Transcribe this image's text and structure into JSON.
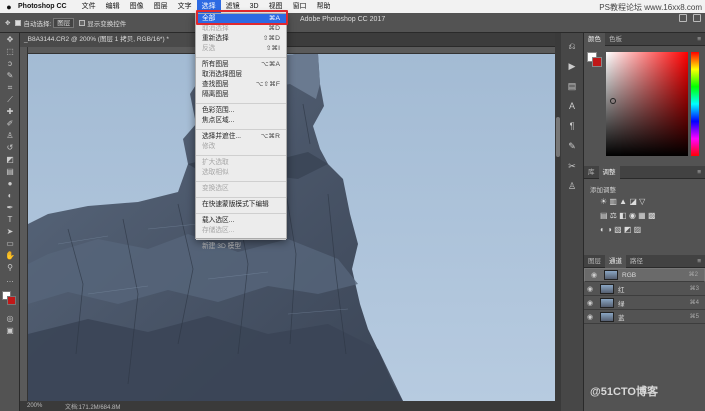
{
  "menubar": {
    "app": "Photoshop CC",
    "items": [
      "文件",
      "编辑",
      "图像",
      "图层",
      "文字",
      "选择",
      "滤镜",
      "3D",
      "视图",
      "窗口",
      "帮助"
    ],
    "active_index": 5
  },
  "options": {
    "auto_select_label": "自动选择:",
    "auto_select_value": "图层",
    "transform_label": "显示变换控件"
  },
  "window_title": "Adobe Photoshop CC 2017",
  "document": {
    "tab": "_B8A3144.CR2 @ 200% (图层 1 拷贝, RGB/16*) *",
    "zoom": "200%",
    "status": "文档:171.2M/684.8M"
  },
  "select_menu": {
    "items": [
      {
        "label": "全部",
        "shortcut": "⌘A",
        "state": "highlight"
      },
      {
        "label": "取消选择",
        "shortcut": "⌘D",
        "state": "disabled"
      },
      {
        "label": "重新选择",
        "shortcut": "⇧⌘D",
        "state": "normal"
      },
      {
        "label": "反选",
        "shortcut": "⇧⌘I",
        "state": "disabled"
      },
      {
        "sep": true
      },
      {
        "label": "所有图层",
        "shortcut": "⌥⌘A",
        "state": "normal"
      },
      {
        "label": "取消选择图层",
        "shortcut": "",
        "state": "normal"
      },
      {
        "label": "查找图层",
        "shortcut": "⌥⇧⌘F",
        "state": "normal"
      },
      {
        "label": "隔离图层",
        "shortcut": "",
        "state": "normal"
      },
      {
        "sep": true
      },
      {
        "label": "色彩范围...",
        "shortcut": "",
        "state": "normal"
      },
      {
        "label": "焦点区域...",
        "shortcut": "",
        "state": "normal"
      },
      {
        "sep": true
      },
      {
        "label": "选择并遮住...",
        "shortcut": "⌥⌘R",
        "state": "normal"
      },
      {
        "label": "修改",
        "shortcut": "",
        "state": "disabled"
      },
      {
        "sep": true
      },
      {
        "label": "扩大选取",
        "shortcut": "",
        "state": "disabled"
      },
      {
        "label": "选取相似",
        "shortcut": "",
        "state": "disabled"
      },
      {
        "sep": true
      },
      {
        "label": "变换选区",
        "shortcut": "",
        "state": "disabled"
      },
      {
        "sep": true
      },
      {
        "label": "在快速蒙版模式下编辑",
        "shortcut": "",
        "state": "normal"
      },
      {
        "sep": true
      },
      {
        "label": "载入选区...",
        "shortcut": "",
        "state": "normal"
      },
      {
        "label": "存储选区...",
        "shortcut": "",
        "state": "disabled"
      },
      {
        "sep": true
      },
      {
        "label": "新建 3D 模型",
        "shortcut": "",
        "state": "disabled"
      }
    ]
  },
  "panels": {
    "color_tabs": [
      "颜色",
      "色板"
    ],
    "adjust_tabs": [
      "库",
      "调整"
    ],
    "adjust_label": "添加调整",
    "adjust_row1": "☀ ▥ ▲ ◪ ▽",
    "adjust_row2": "▤ ⚖ ◧ ◉ ▦ ▩",
    "adjust_row3": "◐ ◑ ▧ ◩ ▨",
    "layer_tabs": [
      "图层",
      "通道",
      "路径"
    ],
    "channels": [
      {
        "name": "RGB",
        "key": "⌘2"
      },
      {
        "name": "红",
        "key": "⌘3"
      },
      {
        "name": "绿",
        "key": "⌘4"
      },
      {
        "name": "蓝",
        "key": "⌘5"
      }
    ]
  },
  "watermarks": {
    "top": "PS教程论坛 www.16xx8.com",
    "bottom": "@51CTO博客"
  },
  "colors": {
    "highlight": "#2d6ae3",
    "outline": "#e0282e",
    "background_swatch": "#c01818"
  }
}
